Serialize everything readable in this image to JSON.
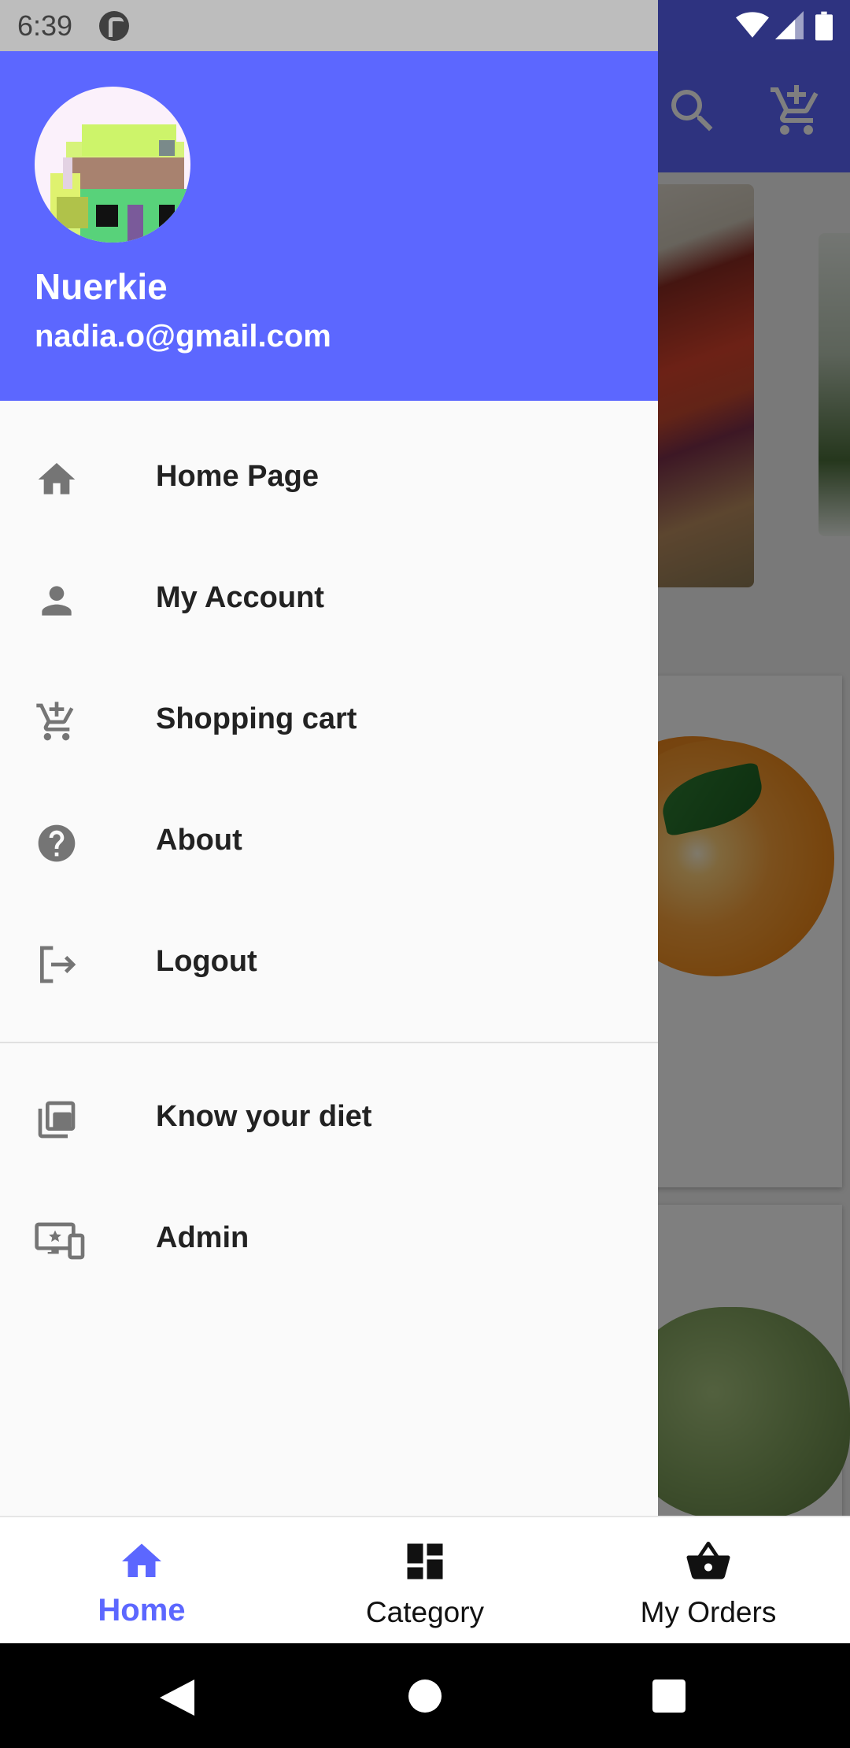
{
  "status_bar": {
    "time": "6:39",
    "icons": [
      "app-notification-icon",
      "wifi-icon",
      "signal-icon",
      "battery-icon"
    ]
  },
  "toolbar": {
    "icons": [
      "search-icon",
      "add-to-cart-icon"
    ]
  },
  "drawer": {
    "header": {
      "name": "Nuerkie",
      "email": "nadia.o@gmail.com",
      "background_color": "#5c67ff"
    },
    "items": [
      {
        "label": "Home Page",
        "icon": "home-icon"
      },
      {
        "label": "My Account",
        "icon": "person-icon"
      },
      {
        "label": "Shopping cart",
        "icon": "add-to-cart-icon"
      },
      {
        "label": "About",
        "icon": "help-circle-icon"
      },
      {
        "label": "Logout",
        "icon": "logout-icon"
      }
    ],
    "secondary_items": [
      {
        "label": "Know your diet",
        "icon": "library-icon"
      },
      {
        "label": "Admin",
        "icon": "admin-devices-icon"
      }
    ]
  },
  "bottom_nav": {
    "tabs": [
      {
        "label": "Home",
        "icon": "home-icon",
        "active": true
      },
      {
        "label": "Category",
        "icon": "dashboard-icon",
        "active": false
      },
      {
        "label": "My Orders",
        "icon": "basket-icon",
        "active": false
      }
    ],
    "active_color": "#5c67ff"
  },
  "system_nav": {
    "buttons": [
      "back-icon",
      "home-circle-icon",
      "recents-icon"
    ]
  }
}
